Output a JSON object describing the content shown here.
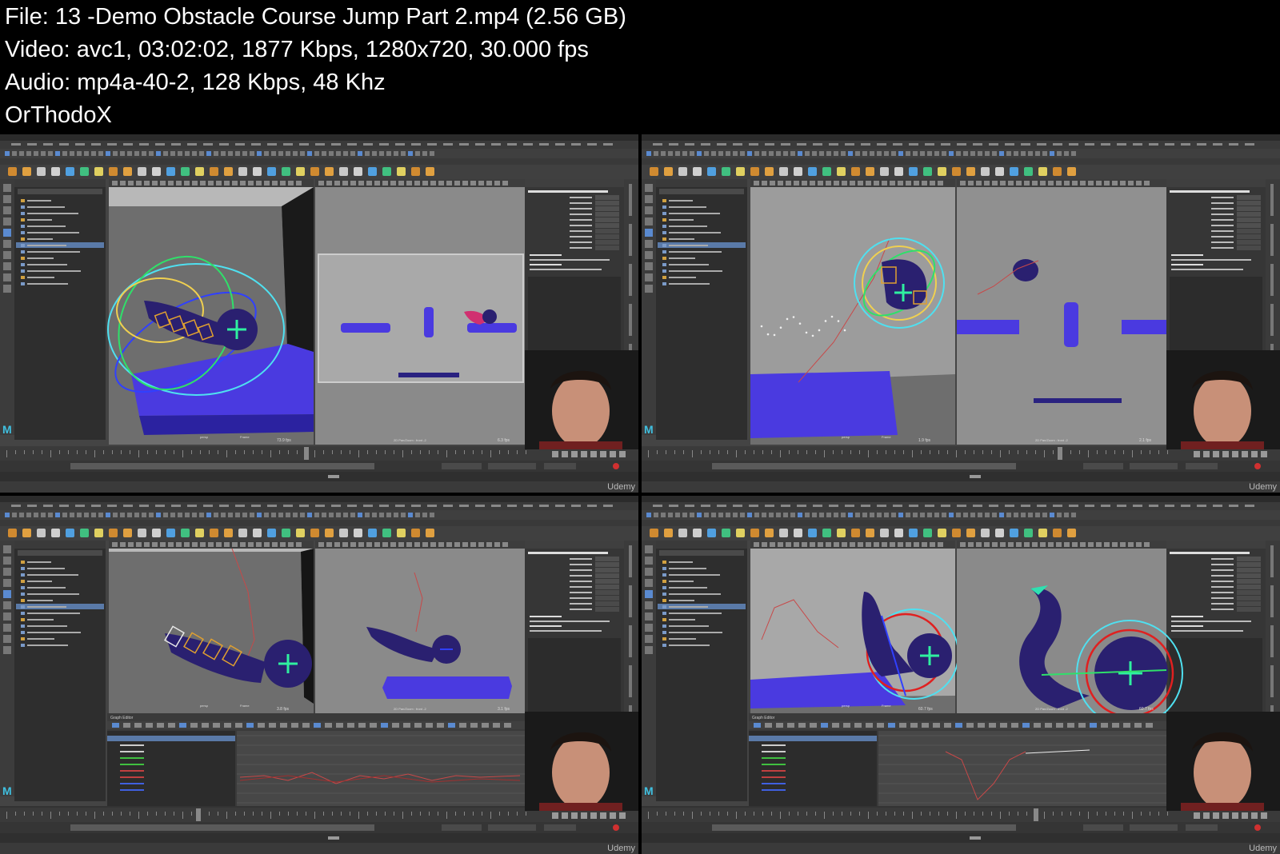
{
  "header": {
    "file": "File: 13 -Demo Obstacle Course Jump Part 2.mp4 (2.56 GB)",
    "video": "Video: avc1, 03:02:02, 1877 Kbps, 1280x720, 30.000 fps",
    "audio": "Audio: mp4a-40-2, 128 Kbps, 48 Khz",
    "author": "OrThodoX"
  },
  "frames": [
    {
      "id": "tl",
      "variant": "a",
      "has_graph_editor": false,
      "watermark": "Udemy",
      "persp_fps": "73.9 fps",
      "front_fps": "6.3 fps",
      "panel_label": "persp",
      "front_label": "2D Pan/Zoom : front -2"
    },
    {
      "id": "tr",
      "variant": "b",
      "has_graph_editor": false,
      "watermark": "Udemy",
      "persp_fps": "1.9 fps",
      "front_fps": "2.1 fps",
      "panel_label": "persp",
      "front_label": "2D Pan/Zoom : front -2"
    },
    {
      "id": "bl",
      "variant": "c",
      "has_graph_editor": true,
      "graph_editor_label": "Graph Editor",
      "watermark": "Udemy",
      "persp_fps": "3.8 fps",
      "front_fps": "3.1 fps",
      "panel_label": "persp",
      "front_label": "2D Pan/Zoom : front -2"
    },
    {
      "id": "br",
      "variant": "d",
      "has_graph_editor": true,
      "graph_editor_label": "Graph Editor",
      "watermark": "Udemy",
      "persp_fps": "60.7 fps",
      "front_fps": "60.7 fps",
      "panel_label": "persp",
      "front_label": "2D Pan/Zoom : front -2"
    }
  ],
  "channel_box": {
    "object": "ExtremeBallRig_v004:tail03_CTL",
    "attrs": [
      "Translate X",
      "Translate Y",
      "Translate Z",
      "Rotate X",
      "Rotate Y",
      "Rotate Z",
      "Scale X",
      "Scale Y",
      "Scale Z",
      "Visibility"
    ],
    "shapes_label": "SHAPES",
    "outputs_label": "OUTPUTS"
  },
  "colors": {
    "maya_bg": "#444444",
    "viewport_bg": "#6e6e6e",
    "wall": "#b4b4b4",
    "platform": "#4a3ae0",
    "character": "#2a2070",
    "ctrl_green": "#2fe06a",
    "ctrl_yellow": "#f0d050",
    "ctrl_cyan": "#4fe0f0",
    "ctrl_blue": "#3040ff",
    "ctrl_red": "#e02020",
    "curve_red": "#c84848"
  }
}
